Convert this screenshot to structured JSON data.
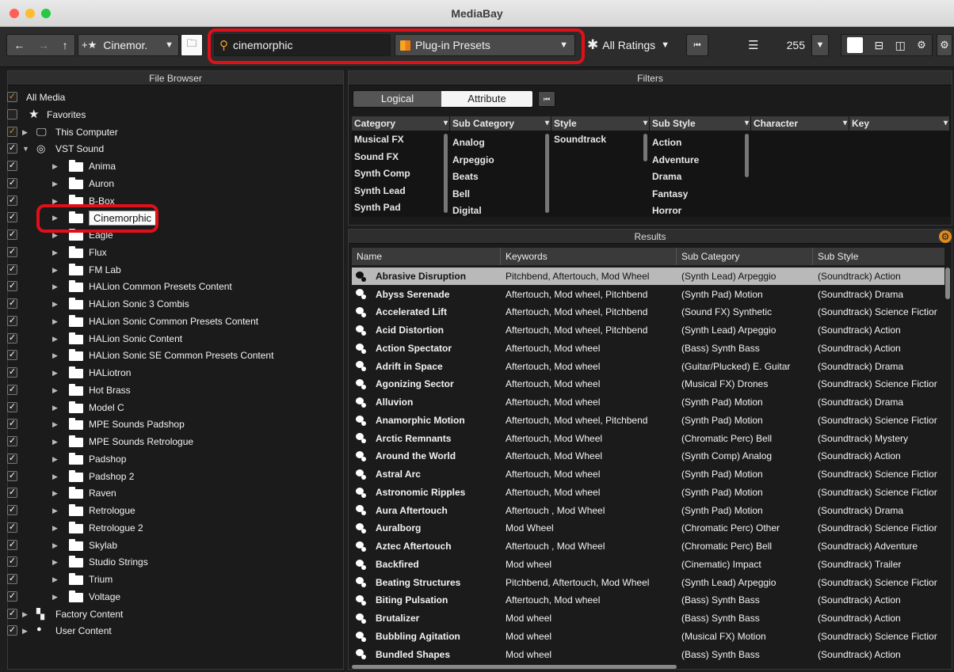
{
  "window": {
    "title": "MediaBay"
  },
  "toolbar": {
    "location": "Cinemor.",
    "search_value": "cinemorphic",
    "type_filter": "Plug-in Presets",
    "ratings": "All Ratings",
    "count": "255"
  },
  "file_browser": {
    "title": "File Browser",
    "items": [
      {
        "label": "All Media",
        "check": "✓",
        "arrow": "",
        "icon": "none"
      },
      {
        "label": "Favorites",
        "check": "",
        "arrow": "",
        "icon": "star"
      },
      {
        "label": "This Computer",
        "check": "✓",
        "arrow": "▶",
        "icon": "monitor"
      },
      {
        "label": "VST Sound",
        "check": "✓",
        "arrow": "▼",
        "icon": "vst"
      },
      {
        "label": "Anima",
        "check": "✓",
        "arrow": "▶",
        "icon": "folder"
      },
      {
        "label": "Auron",
        "check": "✓",
        "arrow": "▶",
        "icon": "folder"
      },
      {
        "label": "B-Box",
        "check": "✓",
        "arrow": "▶",
        "icon": "folder"
      },
      {
        "label": "Cinemorphic",
        "check": "✓",
        "arrow": "▶",
        "icon": "folder"
      },
      {
        "label": "Eagle",
        "check": "✓",
        "arrow": "▶",
        "icon": "folder"
      },
      {
        "label": "Flux",
        "check": "✓",
        "arrow": "▶",
        "icon": "folder"
      },
      {
        "label": "FM Lab",
        "check": "✓",
        "arrow": "▶",
        "icon": "folder"
      },
      {
        "label": "HALion Common Presets Content",
        "check": "✓",
        "arrow": "▶",
        "icon": "folder"
      },
      {
        "label": "HALion Sonic 3 Combis",
        "check": "✓",
        "arrow": "▶",
        "icon": "folder"
      },
      {
        "label": "HALion Sonic Common Presets Content",
        "check": "✓",
        "arrow": "▶",
        "icon": "folder"
      },
      {
        "label": "HALion Sonic Content",
        "check": "✓",
        "arrow": "▶",
        "icon": "folder"
      },
      {
        "label": "HALion Sonic SE Common Presets Content",
        "check": "✓",
        "arrow": "▶",
        "icon": "folder"
      },
      {
        "label": "HALiotron",
        "check": "✓",
        "arrow": "▶",
        "icon": "folder"
      },
      {
        "label": "Hot Brass",
        "check": "✓",
        "arrow": "▶",
        "icon": "folder"
      },
      {
        "label": "Model C",
        "check": "✓",
        "arrow": "▶",
        "icon": "folder"
      },
      {
        "label": "MPE Sounds Padshop",
        "check": "✓",
        "arrow": "▶",
        "icon": "folder"
      },
      {
        "label": "MPE Sounds Retrologue",
        "check": "✓",
        "arrow": "▶",
        "icon": "folder"
      },
      {
        "label": "Padshop",
        "check": "✓",
        "arrow": "▶",
        "icon": "folder"
      },
      {
        "label": "Padshop 2",
        "check": "✓",
        "arrow": "▶",
        "icon": "folder"
      },
      {
        "label": "Raven",
        "check": "✓",
        "arrow": "▶",
        "icon": "folder"
      },
      {
        "label": "Retrologue",
        "check": "✓",
        "arrow": "▶",
        "icon": "folder"
      },
      {
        "label": "Retrologue 2",
        "check": "✓",
        "arrow": "▶",
        "icon": "folder"
      },
      {
        "label": "Skylab",
        "check": "✓",
        "arrow": "▶",
        "icon": "folder"
      },
      {
        "label": "Studio Strings",
        "check": "✓",
        "arrow": "▶",
        "icon": "folder"
      },
      {
        "label": "Trium",
        "check": "✓",
        "arrow": "▶",
        "icon": "folder"
      },
      {
        "label": "Voltage",
        "check": "✓",
        "arrow": "▶",
        "icon": "folder"
      },
      {
        "label": "Factory Content",
        "check": "✓",
        "arrow": "▶",
        "icon": "factory"
      },
      {
        "label": "User Content",
        "check": "✓",
        "arrow": "▶",
        "icon": "user"
      }
    ]
  },
  "filters": {
    "title": "Filters",
    "tabs": [
      "Logical",
      "Attribute"
    ],
    "columns": [
      "Category",
      "Sub Category",
      "Style",
      "Sub Style",
      "Character",
      "Key"
    ],
    "category_values": [
      "Musical FX",
      "Sound FX",
      "Synth Comp",
      "Synth Lead",
      "Synth Pad"
    ],
    "subcategory_values": [
      "Analog",
      "Arpeggio",
      "Beats",
      "Bell",
      "Digital"
    ],
    "style_values": [
      "Soundtrack"
    ],
    "substyle_values": [
      "Action",
      "Adventure",
      "Drama",
      "Fantasy",
      "Horror"
    ]
  },
  "results": {
    "title": "Results",
    "columns": [
      "Name",
      "Keywords",
      "Sub Category",
      "Sub Style"
    ],
    "rows": [
      [
        "Abrasive Disruption",
        "Pitchbend, Aftertouch, Mod Wheel",
        "(Synth Lead) Arpeggio",
        "(Soundtrack) Action"
      ],
      [
        "Abyss Serenade",
        "Aftertouch, Mod wheel, Pitchbend",
        "(Synth Pad) Motion",
        "(Soundtrack) Drama"
      ],
      [
        "Accelerated Lift",
        "Aftertouch, Mod wheel, Pitchbend",
        "(Sound FX) Synthetic",
        "(Soundtrack) Science Fictior"
      ],
      [
        "Acid Distortion",
        "Aftertouch, Mod wheel, Pitchbend",
        "(Synth Lead) Arpeggio",
        "(Soundtrack) Action"
      ],
      [
        "Action Spectator",
        "Aftertouch, Mod wheel",
        "(Bass) Synth Bass",
        "(Soundtrack) Action"
      ],
      [
        "Adrift in Space",
        "Aftertouch, Mod wheel",
        "(Guitar/Plucked) E. Guitar",
        "(Soundtrack) Drama"
      ],
      [
        "Agonizing Sector",
        "Aftertouch, Mod wheel",
        "(Musical FX) Drones",
        "(Soundtrack) Science Fictior"
      ],
      [
        "Alluvion",
        "Aftertouch, Mod wheel",
        "(Synth Pad) Motion",
        "(Soundtrack) Drama"
      ],
      [
        "Anamorphic Motion",
        "Aftertouch, Mod wheel, Pitchbend",
        "(Synth Pad) Motion",
        "(Soundtrack) Science Fictior"
      ],
      [
        "Arctic Remnants",
        "Aftertouch, Mod Wheel",
        "(Chromatic Perc) Bell",
        "(Soundtrack) Mystery"
      ],
      [
        "Around the World",
        "Aftertouch, Mod Wheel",
        "(Synth Comp) Analog",
        "(Soundtrack) Action"
      ],
      [
        "Astral Arc",
        "Aftertouch, Mod wheel",
        "(Synth Pad) Motion",
        "(Soundtrack) Science Fictior"
      ],
      [
        "Astronomic Ripples",
        "Aftertouch, Mod wheel",
        "(Synth Pad) Motion",
        "(Soundtrack) Science Fictior"
      ],
      [
        "Aura Aftertouch",
        "Aftertouch , Mod Wheel",
        "(Synth Pad) Motion",
        "(Soundtrack) Drama"
      ],
      [
        "Auralborg",
        "Mod Wheel",
        "(Chromatic Perc) Other",
        "(Soundtrack) Science Fictior"
      ],
      [
        "Aztec Aftertouch",
        "Aftertouch , Mod Wheel",
        "(Chromatic Perc) Bell",
        "(Soundtrack) Adventure"
      ],
      [
        "Backfired",
        "Mod wheel",
        "(Cinematic) Impact",
        "(Soundtrack) Trailer"
      ],
      [
        "Beating Structures",
        "Pitchbend, Aftertouch, Mod Wheel",
        "(Synth Lead) Arpeggio",
        "(Soundtrack) Science Fictior"
      ],
      [
        "Biting Pulsation",
        "Aftertouch, Mod wheel",
        "(Bass) Synth Bass",
        "(Soundtrack) Action"
      ],
      [
        "Brutalizer",
        "Mod wheel",
        "(Bass) Synth Bass",
        "(Soundtrack) Action"
      ],
      [
        "Bubbling Agitation",
        "Mod wheel",
        "(Musical FX) Motion",
        "(Soundtrack) Science Fictior"
      ],
      [
        "Bundled Shapes",
        "Mod wheel",
        "(Bass) Synth Bass",
        "(Soundtrack) Action"
      ]
    ]
  }
}
